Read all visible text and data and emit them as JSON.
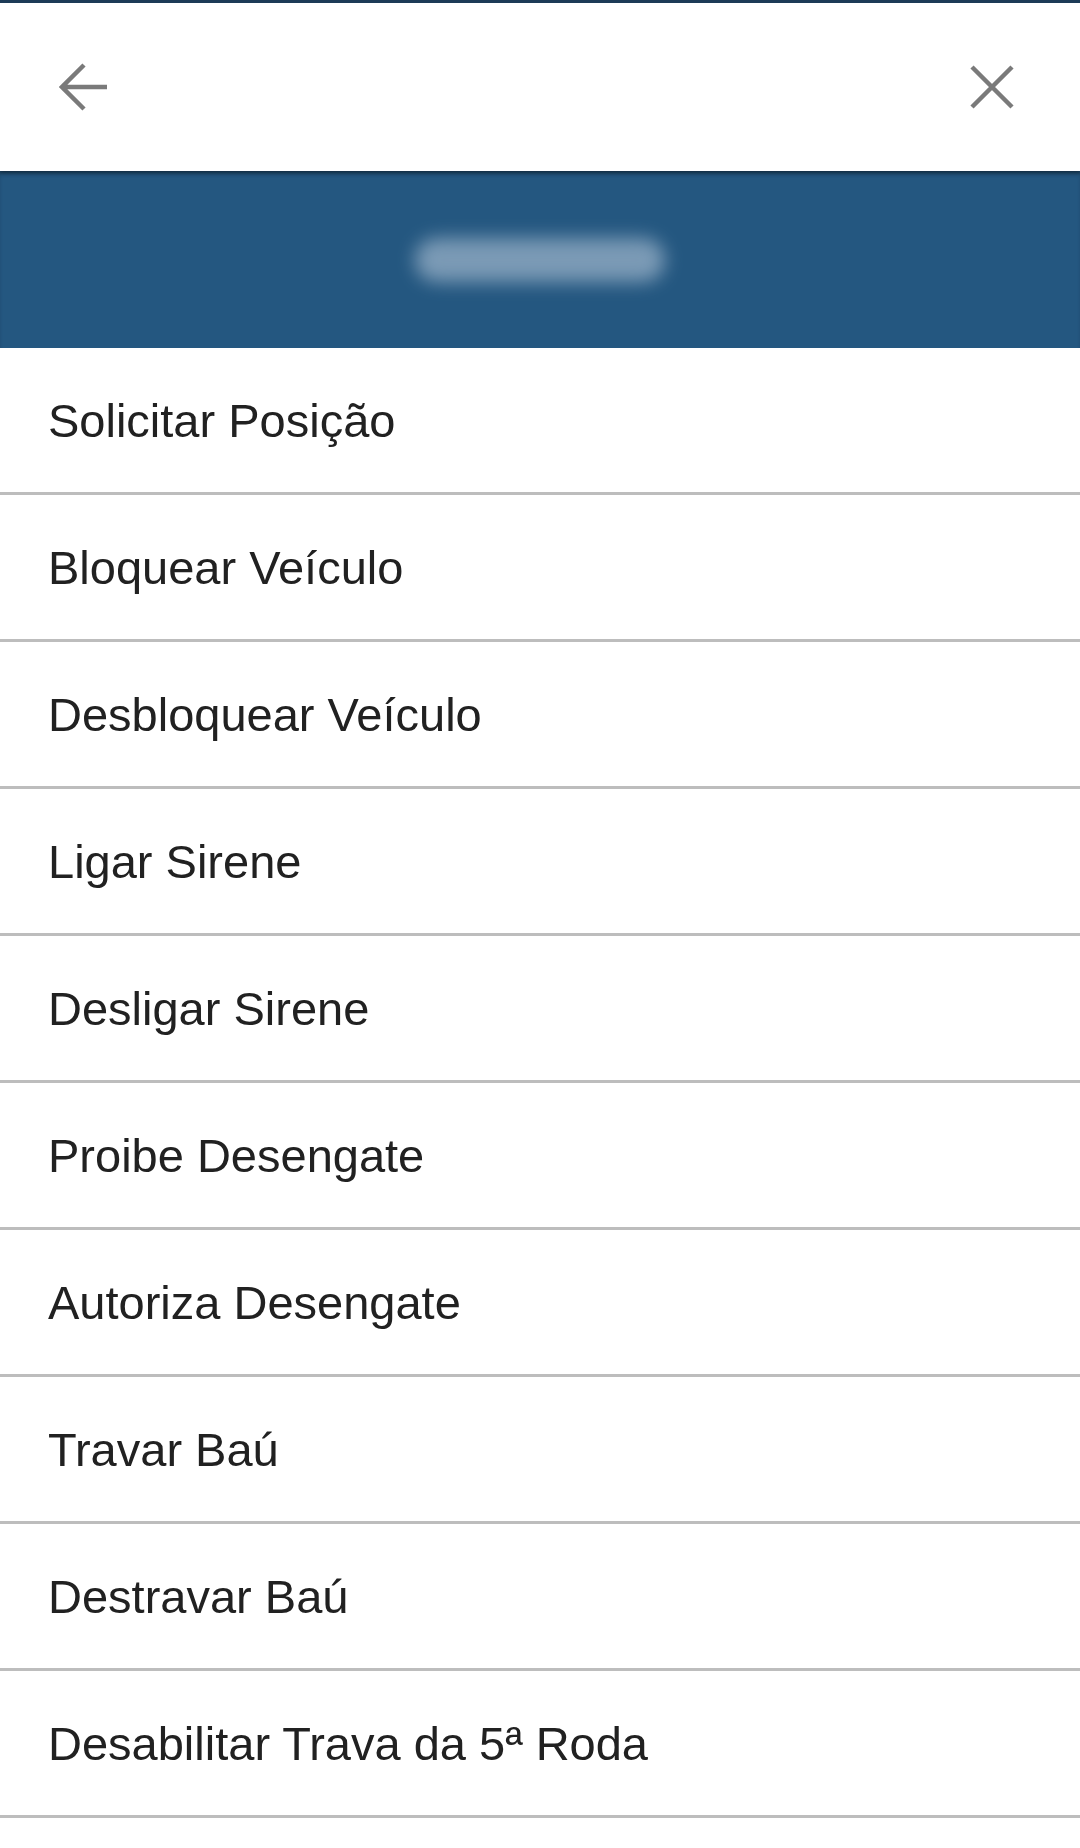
{
  "banner": {
    "title_obscured": true
  },
  "commands": [
    {
      "label": "Solicitar Posição"
    },
    {
      "label": "Bloquear Veículo"
    },
    {
      "label": "Desbloquear Veículo"
    },
    {
      "label": "Ligar Sirene"
    },
    {
      "label": "Desligar Sirene"
    },
    {
      "label": "Proibe Desengate"
    },
    {
      "label": "Autoriza Desengate"
    },
    {
      "label": "Travar Baú"
    },
    {
      "label": "Destravar Baú"
    },
    {
      "label": "Desabilitar Trava da 5ª Roda"
    }
  ]
}
